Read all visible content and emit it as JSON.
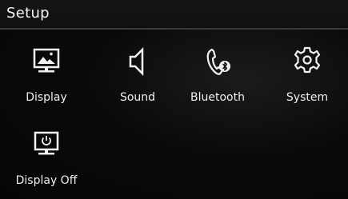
{
  "header": {
    "title": "Setup"
  },
  "menu": {
    "items": [
      {
        "label": "Display",
        "icon": "display-icon"
      },
      {
        "label": "Sound",
        "icon": "speaker-icon"
      },
      {
        "label": "Bluetooth",
        "icon": "bluetooth-phone-icon"
      },
      {
        "label": "System",
        "icon": "gear-icon"
      },
      {
        "label": "Display Off",
        "icon": "display-off-icon"
      }
    ]
  }
}
